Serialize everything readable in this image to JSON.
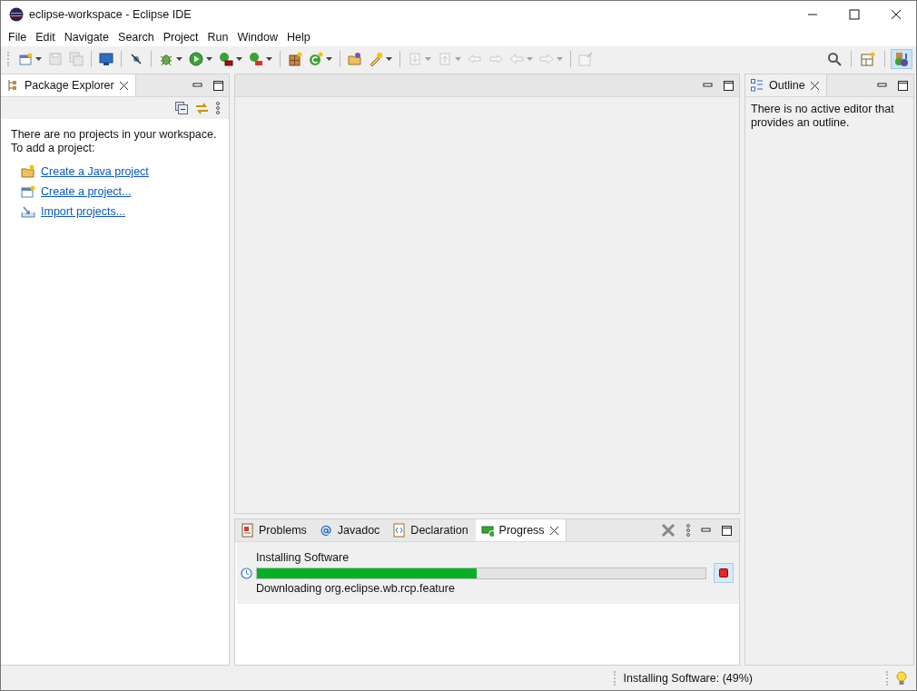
{
  "window": {
    "title": "eclipse-workspace - Eclipse IDE"
  },
  "menu": [
    "File",
    "Edit",
    "Navigate",
    "Search",
    "Project",
    "Run",
    "Window",
    "Help"
  ],
  "toolbar": [
    {
      "kind": "new",
      "disabled": false,
      "dropdown": true
    },
    {
      "kind": "save",
      "disabled": true,
      "dropdown": false
    },
    {
      "kind": "save-all",
      "disabled": true,
      "dropdown": false
    },
    {
      "kind": "separator"
    },
    {
      "kind": "terminal",
      "disabled": false,
      "dropdown": false
    },
    {
      "kind": "separator"
    },
    {
      "kind": "skip-breakpoints",
      "disabled": false,
      "dropdown": false
    },
    {
      "kind": "separator"
    },
    {
      "kind": "debug",
      "disabled": false,
      "dropdown": true
    },
    {
      "kind": "run",
      "disabled": false,
      "dropdown": true
    },
    {
      "kind": "coverage",
      "disabled": false,
      "dropdown": true
    },
    {
      "kind": "external-tools",
      "disabled": false,
      "dropdown": true
    },
    {
      "kind": "separator"
    },
    {
      "kind": "new-package",
      "disabled": false,
      "dropdown": false
    },
    {
      "kind": "new-class",
      "disabled": false,
      "dropdown": true
    },
    {
      "kind": "separator"
    },
    {
      "kind": "open-type",
      "disabled": false,
      "dropdown": false
    },
    {
      "kind": "search-tool",
      "disabled": false,
      "dropdown": true
    },
    {
      "kind": "separator"
    },
    {
      "kind": "next-annotation",
      "disabled": true,
      "dropdown": true
    },
    {
      "kind": "prev-annotation",
      "disabled": true,
      "dropdown": true
    },
    {
      "kind": "last-edit",
      "disabled": true,
      "dropdown": false
    },
    {
      "kind": "next-edit",
      "disabled": true,
      "dropdown": false
    },
    {
      "kind": "back",
      "disabled": true,
      "dropdown": true
    },
    {
      "kind": "forward",
      "disabled": true,
      "dropdown": true
    },
    {
      "kind": "separator"
    },
    {
      "kind": "pin",
      "disabled": true,
      "dropdown": false
    }
  ],
  "toolbar_right": [
    {
      "kind": "search",
      "selected": false
    },
    {
      "kind": "open-perspective",
      "selected": false
    },
    {
      "kind": "java-perspective",
      "selected": true
    }
  ],
  "package_explorer": {
    "tab": {
      "label": "Package Explorer",
      "selected": true
    },
    "message": "There are no projects in your workspace.\nTo add a project:",
    "links": [
      {
        "kind": "java-project",
        "label": "Create a Java project"
      },
      {
        "kind": "project",
        "label": "Create a project..."
      },
      {
        "kind": "import",
        "label": "Import projects..."
      }
    ]
  },
  "outline": {
    "tab": {
      "label": "Outline",
      "selected": true
    },
    "message": "There is no active editor that provides an outline."
  },
  "bottom_panel": {
    "tabs": [
      {
        "kind": "problems",
        "label": "Problems",
        "selected": false
      },
      {
        "kind": "javadoc",
        "label": "Javadoc",
        "selected": false
      },
      {
        "kind": "declaration",
        "label": "Declaration",
        "selected": false
      },
      {
        "kind": "progress",
        "label": "Progress",
        "selected": true
      }
    ],
    "job": {
      "name": "Installing Software",
      "level": 0.49,
      "detail": "Downloading org.eclipse.wb.rcp.feature"
    }
  },
  "status_bar": {
    "message": "Installing Software: (49%)"
  }
}
